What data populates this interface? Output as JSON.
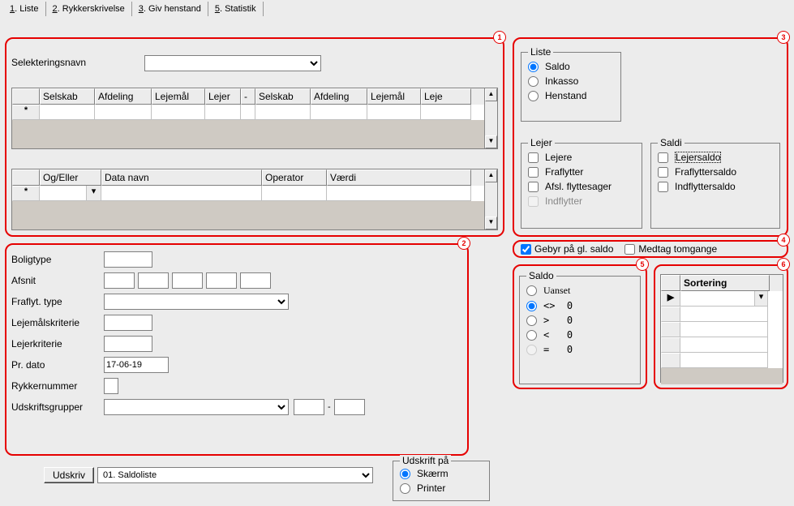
{
  "tabs": [
    {
      "num": "1",
      "label": "Liste"
    },
    {
      "num": "2",
      "label": "Rykkerskrivelse"
    },
    {
      "num": "3",
      "label": "Giv henstand"
    },
    {
      "num": "5",
      "label": "Statistik"
    }
  ],
  "area1": {
    "selektering_label": "Selekteringsnavn",
    "grid1_headers": [
      "",
      "Selskab",
      "Afdeling",
      "Lejemål",
      "Lejer",
      "-",
      "Selskab",
      "Afdeling",
      "Lejemål",
      "Leje"
    ],
    "grid2_headers": [
      "",
      "Og/Eller",
      "Data navn",
      "Operator",
      "Værdi"
    ],
    "star": "*"
  },
  "area2": {
    "boligtype": "Boligtype",
    "afsnit": "Afsnit",
    "fraflyt": "Fraflyt. type",
    "lejemaalskrit": "Lejemålskriterie",
    "lejerkrit": "Lejerkriterie",
    "prdato": "Pr. dato",
    "prdato_val": "17-06-19",
    "rykkernr": "Rykkernummer",
    "udskriftsgr": "Udskriftsgrupper",
    "dash": "-",
    "udskriv_btn": "Udskriv",
    "udskriv_sel": "01. Saldoliste",
    "udskriftpaa": "Udskrift på",
    "skaerm": "Skærm",
    "printer": "Printer"
  },
  "area3": {
    "liste": "Liste",
    "saldo": "Saldo",
    "inkasso": "Inkasso",
    "henstand": "Henstand",
    "lejer": "Lejer",
    "lejere": "Lejere",
    "fraflytter": "Fraflytter",
    "afsl": "Afsl. flyttesager",
    "indflytter": "Indflytter",
    "saldi": "Saldi",
    "lejersaldo": "Lejersaldo",
    "fraflyttersaldo": "Fraflyttersaldo",
    "indflyttersaldo": "Indflyttersaldo"
  },
  "area4": {
    "gebyr": "Gebyr på gl. saldo",
    "medtag": "Medtag tomgange"
  },
  "area5": {
    "saldo": "Saldo",
    "uanset": "Uanset",
    "neq": "<>  0",
    "gt": ">   0",
    "lt": "<   0",
    "eq": "=   0"
  },
  "area6": {
    "sortering": "Sortering"
  },
  "badges": {
    "b1": "1",
    "b2": "2",
    "b3": "3",
    "b4": "4",
    "b5": "5",
    "b6": "6"
  }
}
